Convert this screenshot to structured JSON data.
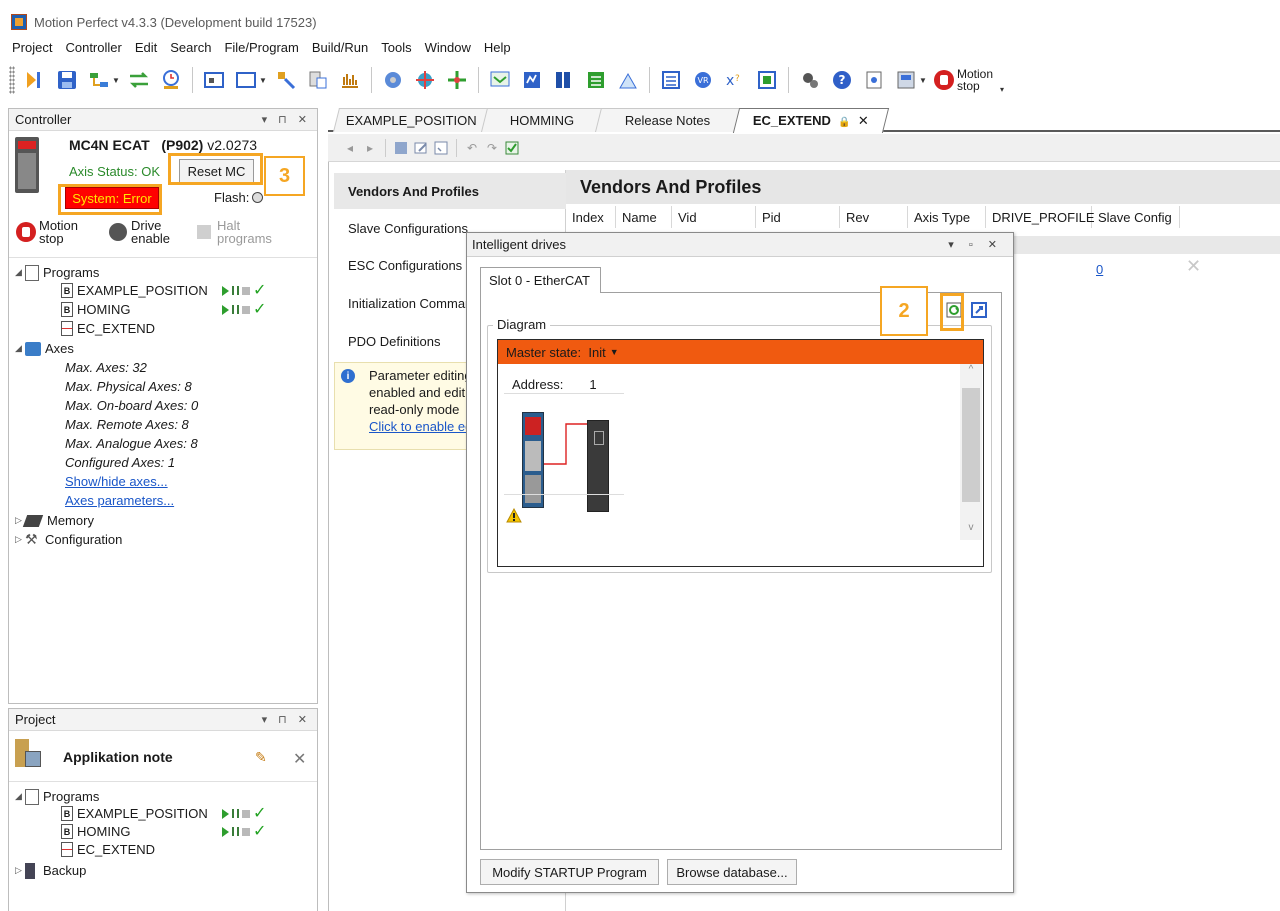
{
  "app": {
    "title": "Motion Perfect v4.3.3 (Development build 17523)"
  },
  "menu": [
    "Project",
    "Controller",
    "Edit",
    "Search",
    "File/Program",
    "Build/Run",
    "Tools",
    "Window",
    "Help"
  ],
  "toolbar": {
    "motion_stop_line1": "Motion",
    "motion_stop_line2": "stop"
  },
  "controller_panel": {
    "title": "Controller",
    "device_name": "MC4N ECAT",
    "device_code": "(P902)",
    "version": "v2.0273",
    "axis_status": "Axis Status: OK",
    "reset_button": "Reset MC",
    "system_status": "System: Error",
    "flash_label": "Flash:",
    "motion_stop_line1": "Motion",
    "motion_stop_line2": "stop",
    "drive_enable_line1": "Drive",
    "drive_enable_line2": "enable",
    "halt_line1": "Halt",
    "halt_line2": "programs",
    "tree": {
      "programs_label": "Programs",
      "programs": [
        "EXAMPLE_POSITION",
        "HOMING",
        "EC_EXTEND"
      ],
      "axes_label": "Axes",
      "axes_info": [
        "Max. Axes: 32",
        "Max. Physical Axes: 8",
        "Max. On-board Axes: 0",
        "Max. Remote Axes: 8",
        "Max. Analogue Axes: 8",
        "Configured Axes: 1"
      ],
      "show_hide_link": "Show/hide axes...",
      "axes_params_link": "Axes parameters...",
      "memory_label": "Memory",
      "configuration_label": "Configuration"
    }
  },
  "project_panel": {
    "title": "Project",
    "project_name": "Applikation note",
    "programs_label": "Programs",
    "programs": [
      "EXAMPLE_POSITION",
      "HOMING",
      "EC_EXTEND"
    ],
    "backup_label": "Backup"
  },
  "doc_tabs": [
    "EXAMPLE_POSITION",
    "HOMMING",
    "Release Notes",
    "EC_EXTEND"
  ],
  "ec_extend": {
    "nav": [
      "Vendors And Profiles",
      "Slave Configurations",
      "ESC Configurations",
      "Initialization Commands",
      "PDO Definitions"
    ],
    "info_text": [
      "Parameter editing is",
      "enabled and editing",
      "read-only mode"
    ],
    "info_link": "Click to enable editing",
    "section_title": "Vendors And Profiles",
    "columns": [
      "Index",
      "Name",
      "Vid",
      "Pid",
      "Rev",
      "Axis Type",
      "DRIVE_PROFILE",
      "Slave Config"
    ],
    "row": {
      "slave_config": "0"
    }
  },
  "drives_window": {
    "title": "Intelligent drives",
    "tab": "Slot 0 - EtherCAT",
    "group_label": "Diagram",
    "master_state_label": "Master state:",
    "master_state_value": "Init",
    "address_label": "Address:",
    "address_value": "1",
    "modify_button": "Modify STARTUP Program",
    "browse_button": "Browse database..."
  },
  "annotations": {
    "callout_2": "2",
    "callout_3": "3",
    "color": "#f5a623"
  },
  "colors": {
    "error_bg": "#ff0000",
    "master_bar": "#f05a10",
    "ok_text": "#2a8a2a"
  }
}
